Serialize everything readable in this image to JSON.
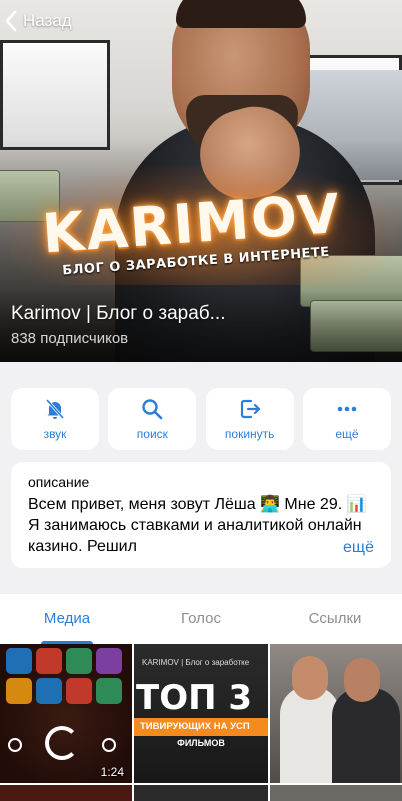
{
  "header": {
    "back_label": "Назад"
  },
  "banner": {
    "brand": "KARIMOV",
    "brand_subtitle": "БЛОГ О ЗАРАБОТКЕ В ИНТЕРНЕТЕ"
  },
  "channel": {
    "name": "Karimov | Блог о зараб...",
    "subscribers": "838 подписчиков"
  },
  "actions": [
    {
      "label": "звук",
      "icon": "bell-slash-icon"
    },
    {
      "label": "поиск",
      "icon": "search-icon"
    },
    {
      "label": "покинуть",
      "icon": "leave-icon"
    },
    {
      "label": "ещё",
      "icon": "more-icon"
    }
  ],
  "description": {
    "title": "описание",
    "text": "Всем привет, меня зовут Лёша 👨‍💻 Мне 29. 📊 Я занимаюсь ставками и аналитикой онлайн казино. Решил",
    "more_label": "ещё"
  },
  "tabs": [
    {
      "label": "Медиа",
      "active": true
    },
    {
      "label": "Голос",
      "active": false
    },
    {
      "label": "Ссылки",
      "active": false
    }
  ],
  "media": {
    "video_duration": "1:24",
    "thumb2_header": "KARIMOV | Блог о заработке",
    "thumb2_title": "ТОП 3",
    "thumb2_strip": "ТИВИРУЮЩИХ НА УСП",
    "thumb2_subtitle": "ФИЛЬМОВ"
  },
  "colors": {
    "accent": "#2c7ddb",
    "background": "#f1f1f4",
    "card": "#ffffff"
  }
}
